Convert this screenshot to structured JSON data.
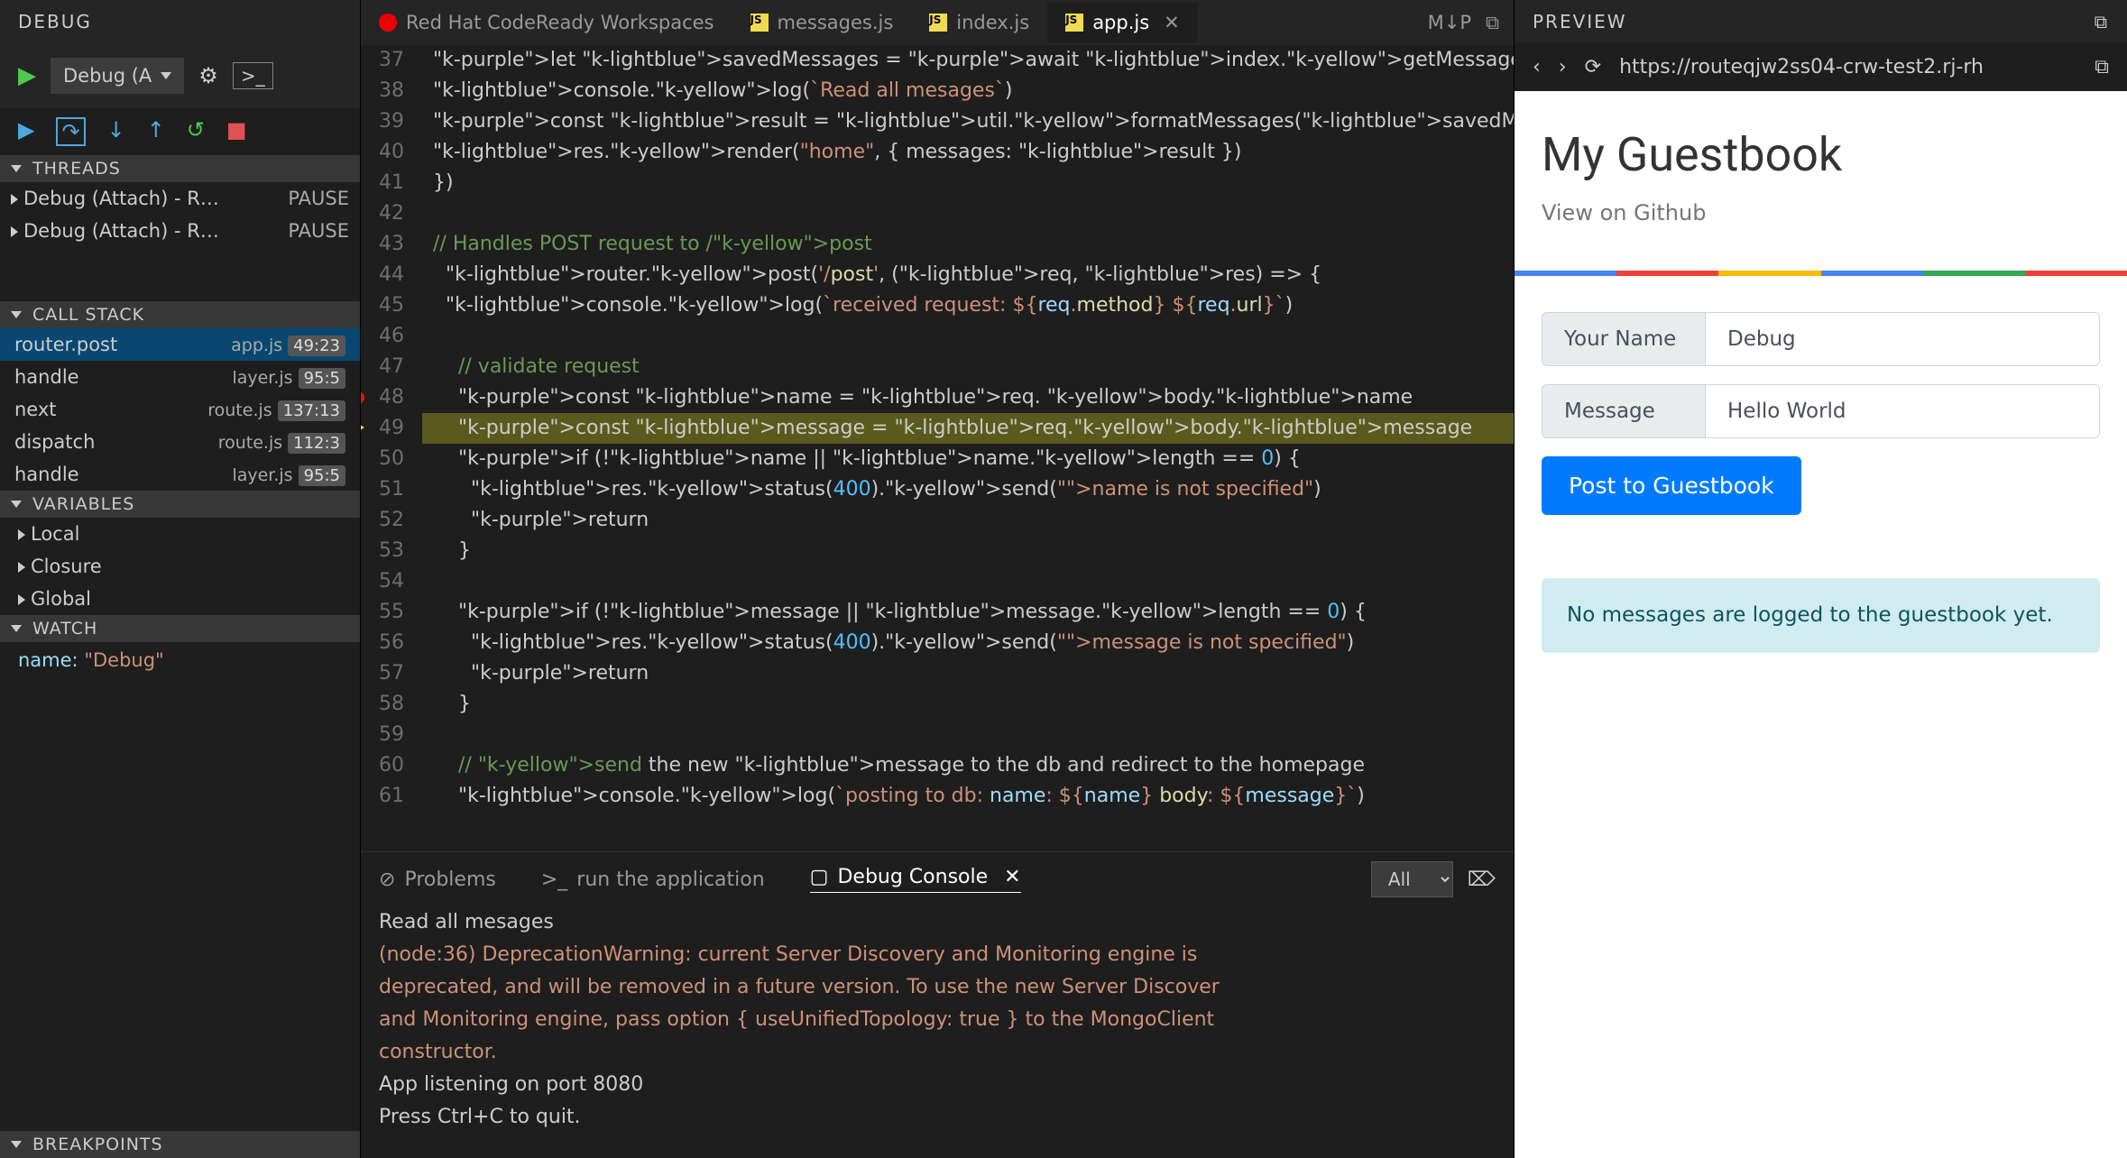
{
  "sidebar": {
    "title": "DEBUG",
    "config": "Debug (A",
    "threads_hdr": "THREADS",
    "threads": [
      {
        "name": "Debug (Attach) - R…",
        "status": "PAUSE"
      },
      {
        "name": "Debug (Attach) - R…",
        "status": "PAUSE"
      }
    ],
    "callstack_hdr": "CALL STACK",
    "callstack": [
      {
        "fn": "router.post",
        "file": "app.js",
        "loc": "49:23"
      },
      {
        "fn": "handle",
        "file": "layer.js",
        "loc": "95:5"
      },
      {
        "fn": "next",
        "file": "route.js",
        "loc": "137:13"
      },
      {
        "fn": "dispatch",
        "file": "route.js",
        "loc": "112:3"
      },
      {
        "fn": "handle",
        "file": "layer.js",
        "loc": "95:5"
      }
    ],
    "variables_hdr": "VARIABLES",
    "variables": [
      "Local",
      "Closure",
      "Global"
    ],
    "watch_hdr": "WATCH",
    "watch": {
      "name": "name:",
      "value": "\"Debug\""
    },
    "breakpoints_hdr": "BREAKPOINTS"
  },
  "tabs": [
    {
      "label": "Red Hat CodeReady Workspaces",
      "icon": "redhat"
    },
    {
      "label": "messages.js",
      "icon": "js"
    },
    {
      "label": "index.js",
      "icon": "js"
    },
    {
      "label": "app.js",
      "icon": "js",
      "active": true,
      "close": true
    }
  ],
  "tab_right_icons": [
    "M↓P",
    "⧉"
  ],
  "editor": {
    "first_line": 37,
    "lines": [
      "let savedMessages = await index.getMessages();",
      "console.log(`Read all mesages`)",
      "const result = util.formatMessages(savedMessages)",
      "res.render(\"home\", { messages: result })",
      "})",
      "",
      "// Handles POST request to /post",
      "router.post('/post', (req, res) => {",
      "console.log(`received request: ${req.method} ${req.url}`)",
      "",
      "  // validate request",
      "  const name = req. body.name",
      "  const message = req.body.message",
      "  if (!name || name.length == 0) {",
      "    res.status(400).send(\"name is not specified\")",
      "    return",
      "  }",
      "",
      "  if (!message || message.length == 0) {",
      "    res.status(400).send(\"message is not specified\")",
      "    return",
      "  }",
      "",
      "  // send the new message to the db and redirect to the homepage",
      "  console.log(`posting to db: name: ${name} body: ${message}`)"
    ],
    "breakpoint_line": 48,
    "current_line": 49
  },
  "panel": {
    "tabs": {
      "problems": "Problems",
      "run": "run the application",
      "debug": "Debug Console"
    },
    "filter": "All",
    "output": [
      {
        "t": "log",
        "s": "Read all mesages"
      },
      {
        "t": "warn",
        "s": "(node:36) DeprecationWarning: current Server Discovery and Monitoring engine is"
      },
      {
        "t": "warn",
        "s": "deprecated, and will be removed in a future version. To use the new Server Discover"
      },
      {
        "t": "warn",
        "s": "and Monitoring engine, pass option { useUnifiedTopology: true } to the MongoClient"
      },
      {
        "t": "warn",
        "s": "constructor."
      },
      {
        "t": "log",
        "s": "App listening on port 8080"
      },
      {
        "t": "log",
        "s": "Press Ctrl+C to quit."
      }
    ]
  },
  "preview": {
    "title": "PREVIEW",
    "url": "https://routeqjw2ss04-crw-test2.rj-rh",
    "gb_title": "My Guestbook",
    "gb_link": "View on Github",
    "name_lbl": "Your Name",
    "name_val": "Debug",
    "msg_lbl": "Message",
    "msg_val": "Hello World",
    "btn": "Post to Guestbook",
    "alert": "No messages are logged to the guestbook yet.",
    "stripe": [
      "#4285F4",
      "#EA4335",
      "#FBBC05",
      "#4285F4",
      "#34A853",
      "#EA4335"
    ]
  }
}
